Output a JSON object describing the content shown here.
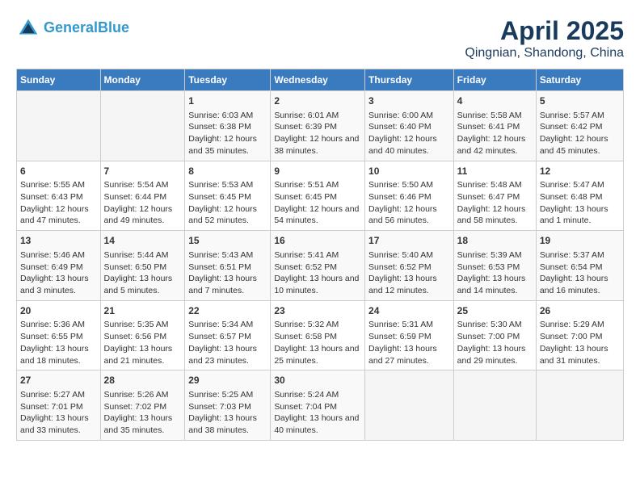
{
  "header": {
    "logo_line1": "General",
    "logo_line2": "Blue",
    "title": "April 2025",
    "subtitle": "Qingnian, Shandong, China"
  },
  "weekdays": [
    "Sunday",
    "Monday",
    "Tuesday",
    "Wednesday",
    "Thursday",
    "Friday",
    "Saturday"
  ],
  "weeks": [
    [
      {
        "day": "",
        "sunrise": "",
        "sunset": "",
        "daylight": ""
      },
      {
        "day": "",
        "sunrise": "",
        "sunset": "",
        "daylight": ""
      },
      {
        "day": "1",
        "sunrise": "Sunrise: 6:03 AM",
        "sunset": "Sunset: 6:38 PM",
        "daylight": "Daylight: 12 hours and 35 minutes."
      },
      {
        "day": "2",
        "sunrise": "Sunrise: 6:01 AM",
        "sunset": "Sunset: 6:39 PM",
        "daylight": "Daylight: 12 hours and 38 minutes."
      },
      {
        "day": "3",
        "sunrise": "Sunrise: 6:00 AM",
        "sunset": "Sunset: 6:40 PM",
        "daylight": "Daylight: 12 hours and 40 minutes."
      },
      {
        "day": "4",
        "sunrise": "Sunrise: 5:58 AM",
        "sunset": "Sunset: 6:41 PM",
        "daylight": "Daylight: 12 hours and 42 minutes."
      },
      {
        "day": "5",
        "sunrise": "Sunrise: 5:57 AM",
        "sunset": "Sunset: 6:42 PM",
        "daylight": "Daylight: 12 hours and 45 minutes."
      }
    ],
    [
      {
        "day": "6",
        "sunrise": "Sunrise: 5:55 AM",
        "sunset": "Sunset: 6:43 PM",
        "daylight": "Daylight: 12 hours and 47 minutes."
      },
      {
        "day": "7",
        "sunrise": "Sunrise: 5:54 AM",
        "sunset": "Sunset: 6:44 PM",
        "daylight": "Daylight: 12 hours and 49 minutes."
      },
      {
        "day": "8",
        "sunrise": "Sunrise: 5:53 AM",
        "sunset": "Sunset: 6:45 PM",
        "daylight": "Daylight: 12 hours and 52 minutes."
      },
      {
        "day": "9",
        "sunrise": "Sunrise: 5:51 AM",
        "sunset": "Sunset: 6:45 PM",
        "daylight": "Daylight: 12 hours and 54 minutes."
      },
      {
        "day": "10",
        "sunrise": "Sunrise: 5:50 AM",
        "sunset": "Sunset: 6:46 PM",
        "daylight": "Daylight: 12 hours and 56 minutes."
      },
      {
        "day": "11",
        "sunrise": "Sunrise: 5:48 AM",
        "sunset": "Sunset: 6:47 PM",
        "daylight": "Daylight: 12 hours and 58 minutes."
      },
      {
        "day": "12",
        "sunrise": "Sunrise: 5:47 AM",
        "sunset": "Sunset: 6:48 PM",
        "daylight": "Daylight: 13 hours and 1 minute."
      }
    ],
    [
      {
        "day": "13",
        "sunrise": "Sunrise: 5:46 AM",
        "sunset": "Sunset: 6:49 PM",
        "daylight": "Daylight: 13 hours and 3 minutes."
      },
      {
        "day": "14",
        "sunrise": "Sunrise: 5:44 AM",
        "sunset": "Sunset: 6:50 PM",
        "daylight": "Daylight: 13 hours and 5 minutes."
      },
      {
        "day": "15",
        "sunrise": "Sunrise: 5:43 AM",
        "sunset": "Sunset: 6:51 PM",
        "daylight": "Daylight: 13 hours and 7 minutes."
      },
      {
        "day": "16",
        "sunrise": "Sunrise: 5:41 AM",
        "sunset": "Sunset: 6:52 PM",
        "daylight": "Daylight: 13 hours and 10 minutes."
      },
      {
        "day": "17",
        "sunrise": "Sunrise: 5:40 AM",
        "sunset": "Sunset: 6:52 PM",
        "daylight": "Daylight: 13 hours and 12 minutes."
      },
      {
        "day": "18",
        "sunrise": "Sunrise: 5:39 AM",
        "sunset": "Sunset: 6:53 PM",
        "daylight": "Daylight: 13 hours and 14 minutes."
      },
      {
        "day": "19",
        "sunrise": "Sunrise: 5:37 AM",
        "sunset": "Sunset: 6:54 PM",
        "daylight": "Daylight: 13 hours and 16 minutes."
      }
    ],
    [
      {
        "day": "20",
        "sunrise": "Sunrise: 5:36 AM",
        "sunset": "Sunset: 6:55 PM",
        "daylight": "Daylight: 13 hours and 18 minutes."
      },
      {
        "day": "21",
        "sunrise": "Sunrise: 5:35 AM",
        "sunset": "Sunset: 6:56 PM",
        "daylight": "Daylight: 13 hours and 21 minutes."
      },
      {
        "day": "22",
        "sunrise": "Sunrise: 5:34 AM",
        "sunset": "Sunset: 6:57 PM",
        "daylight": "Daylight: 13 hours and 23 minutes."
      },
      {
        "day": "23",
        "sunrise": "Sunrise: 5:32 AM",
        "sunset": "Sunset: 6:58 PM",
        "daylight": "Daylight: 13 hours and 25 minutes."
      },
      {
        "day": "24",
        "sunrise": "Sunrise: 5:31 AM",
        "sunset": "Sunset: 6:59 PM",
        "daylight": "Daylight: 13 hours and 27 minutes."
      },
      {
        "day": "25",
        "sunrise": "Sunrise: 5:30 AM",
        "sunset": "Sunset: 7:00 PM",
        "daylight": "Daylight: 13 hours and 29 minutes."
      },
      {
        "day": "26",
        "sunrise": "Sunrise: 5:29 AM",
        "sunset": "Sunset: 7:00 PM",
        "daylight": "Daylight: 13 hours and 31 minutes."
      }
    ],
    [
      {
        "day": "27",
        "sunrise": "Sunrise: 5:27 AM",
        "sunset": "Sunset: 7:01 PM",
        "daylight": "Daylight: 13 hours and 33 minutes."
      },
      {
        "day": "28",
        "sunrise": "Sunrise: 5:26 AM",
        "sunset": "Sunset: 7:02 PM",
        "daylight": "Daylight: 13 hours and 35 minutes."
      },
      {
        "day": "29",
        "sunrise": "Sunrise: 5:25 AM",
        "sunset": "Sunset: 7:03 PM",
        "daylight": "Daylight: 13 hours and 38 minutes."
      },
      {
        "day": "30",
        "sunrise": "Sunrise: 5:24 AM",
        "sunset": "Sunset: 7:04 PM",
        "daylight": "Daylight: 13 hours and 40 minutes."
      },
      {
        "day": "",
        "sunrise": "",
        "sunset": "",
        "daylight": ""
      },
      {
        "day": "",
        "sunrise": "",
        "sunset": "",
        "daylight": ""
      },
      {
        "day": "",
        "sunrise": "",
        "sunset": "",
        "daylight": ""
      }
    ]
  ]
}
